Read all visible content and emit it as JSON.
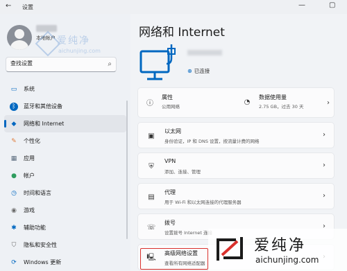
{
  "window": {
    "app_title": "设置",
    "back_icon": "back-arrow-icon",
    "controls": [
      "—",
      "▢"
    ]
  },
  "user": {
    "account_type": "本地帐户"
  },
  "search": {
    "placeholder": "查找设置",
    "value": "查找设置"
  },
  "sidebar": {
    "items": [
      {
        "label": "系统",
        "icon": "monitor-icon",
        "color": "#0067c0"
      },
      {
        "label": "蓝牙和其他设备",
        "icon": "bluetooth-icon",
        "color": "#0067c0"
      },
      {
        "label": "网络和 Internet",
        "icon": "wifi-icon",
        "color": "#0067c0",
        "active": true
      },
      {
        "label": "个性化",
        "icon": "brush-icon",
        "color": "#e07b39"
      },
      {
        "label": "应用",
        "icon": "apps-icon",
        "color": "#5a6b7d"
      },
      {
        "label": "帐户",
        "icon": "person-icon",
        "color": "#2e9c5e"
      },
      {
        "label": "时间和语言",
        "icon": "globe-clock-icon",
        "color": "#0067c0"
      },
      {
        "label": "游戏",
        "icon": "gamepad-icon",
        "color": "#6b6b6b"
      },
      {
        "label": "辅助功能",
        "icon": "accessibility-icon",
        "color": "#0067c0"
      },
      {
        "label": "隐私和安全性",
        "icon": "shield-icon",
        "color": "#6b6b6b"
      },
      {
        "label": "Windows 更新",
        "icon": "update-icon",
        "color": "#0067c0"
      }
    ]
  },
  "main": {
    "title": "网络和 Internet",
    "connection_status": "已连接",
    "properties": {
      "title": "属性",
      "subtitle": "公用网络"
    },
    "data_usage": {
      "title": "数据使用量",
      "subtitle": "2.75 GB，过去 30 天"
    },
    "cards": [
      {
        "title": "以太网",
        "subtitle": "身份验证，IP 和 DNS 设置，按流量计费的网络",
        "icon": "ethernet-icon"
      },
      {
        "title": "VPN",
        "subtitle": "添加、连接、管理",
        "icon": "vpn-shield-icon"
      },
      {
        "title": "代理",
        "subtitle": "用于 Wi-Fi 和以太网连接的代理服务器",
        "icon": "proxy-icon"
      },
      {
        "title": "拨号",
        "subtitle": "设置拨号 Internet 连接",
        "icon": "dialup-icon"
      },
      {
        "title": "高级网络设置",
        "subtitle": "查看所有网络适配器",
        "icon": "advanced-network-icon"
      }
    ],
    "accent_color": "#0067c0",
    "highlight_color": "#d9302c"
  },
  "watermark": {
    "cn": "爱纯净",
    "en": "aichunjing.com"
  }
}
